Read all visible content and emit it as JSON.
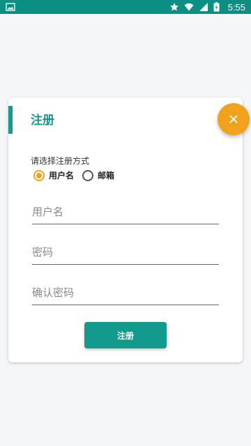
{
  "status_bar": {
    "time": "5:55",
    "icons": [
      "image-icon",
      "star-icon",
      "wifi-icon",
      "signal-icon",
      "battery-icon"
    ],
    "background": "#0b8f82"
  },
  "dialog": {
    "title": "注册",
    "close_icon": "close-icon",
    "subtitle": "请选择注册方式",
    "options": [
      {
        "label": "用户名",
        "checked": true
      },
      {
        "label": "邮箱",
        "checked": false
      }
    ],
    "fields": [
      {
        "placeholder": "用户名",
        "value": ""
      },
      {
        "placeholder": "密码",
        "value": ""
      },
      {
        "placeholder": "确认密码",
        "value": ""
      }
    ],
    "submit_label": "注册"
  },
  "colors": {
    "primary": "#129a8d",
    "accent": "#f1a21c",
    "background": "#f5f6f8"
  }
}
